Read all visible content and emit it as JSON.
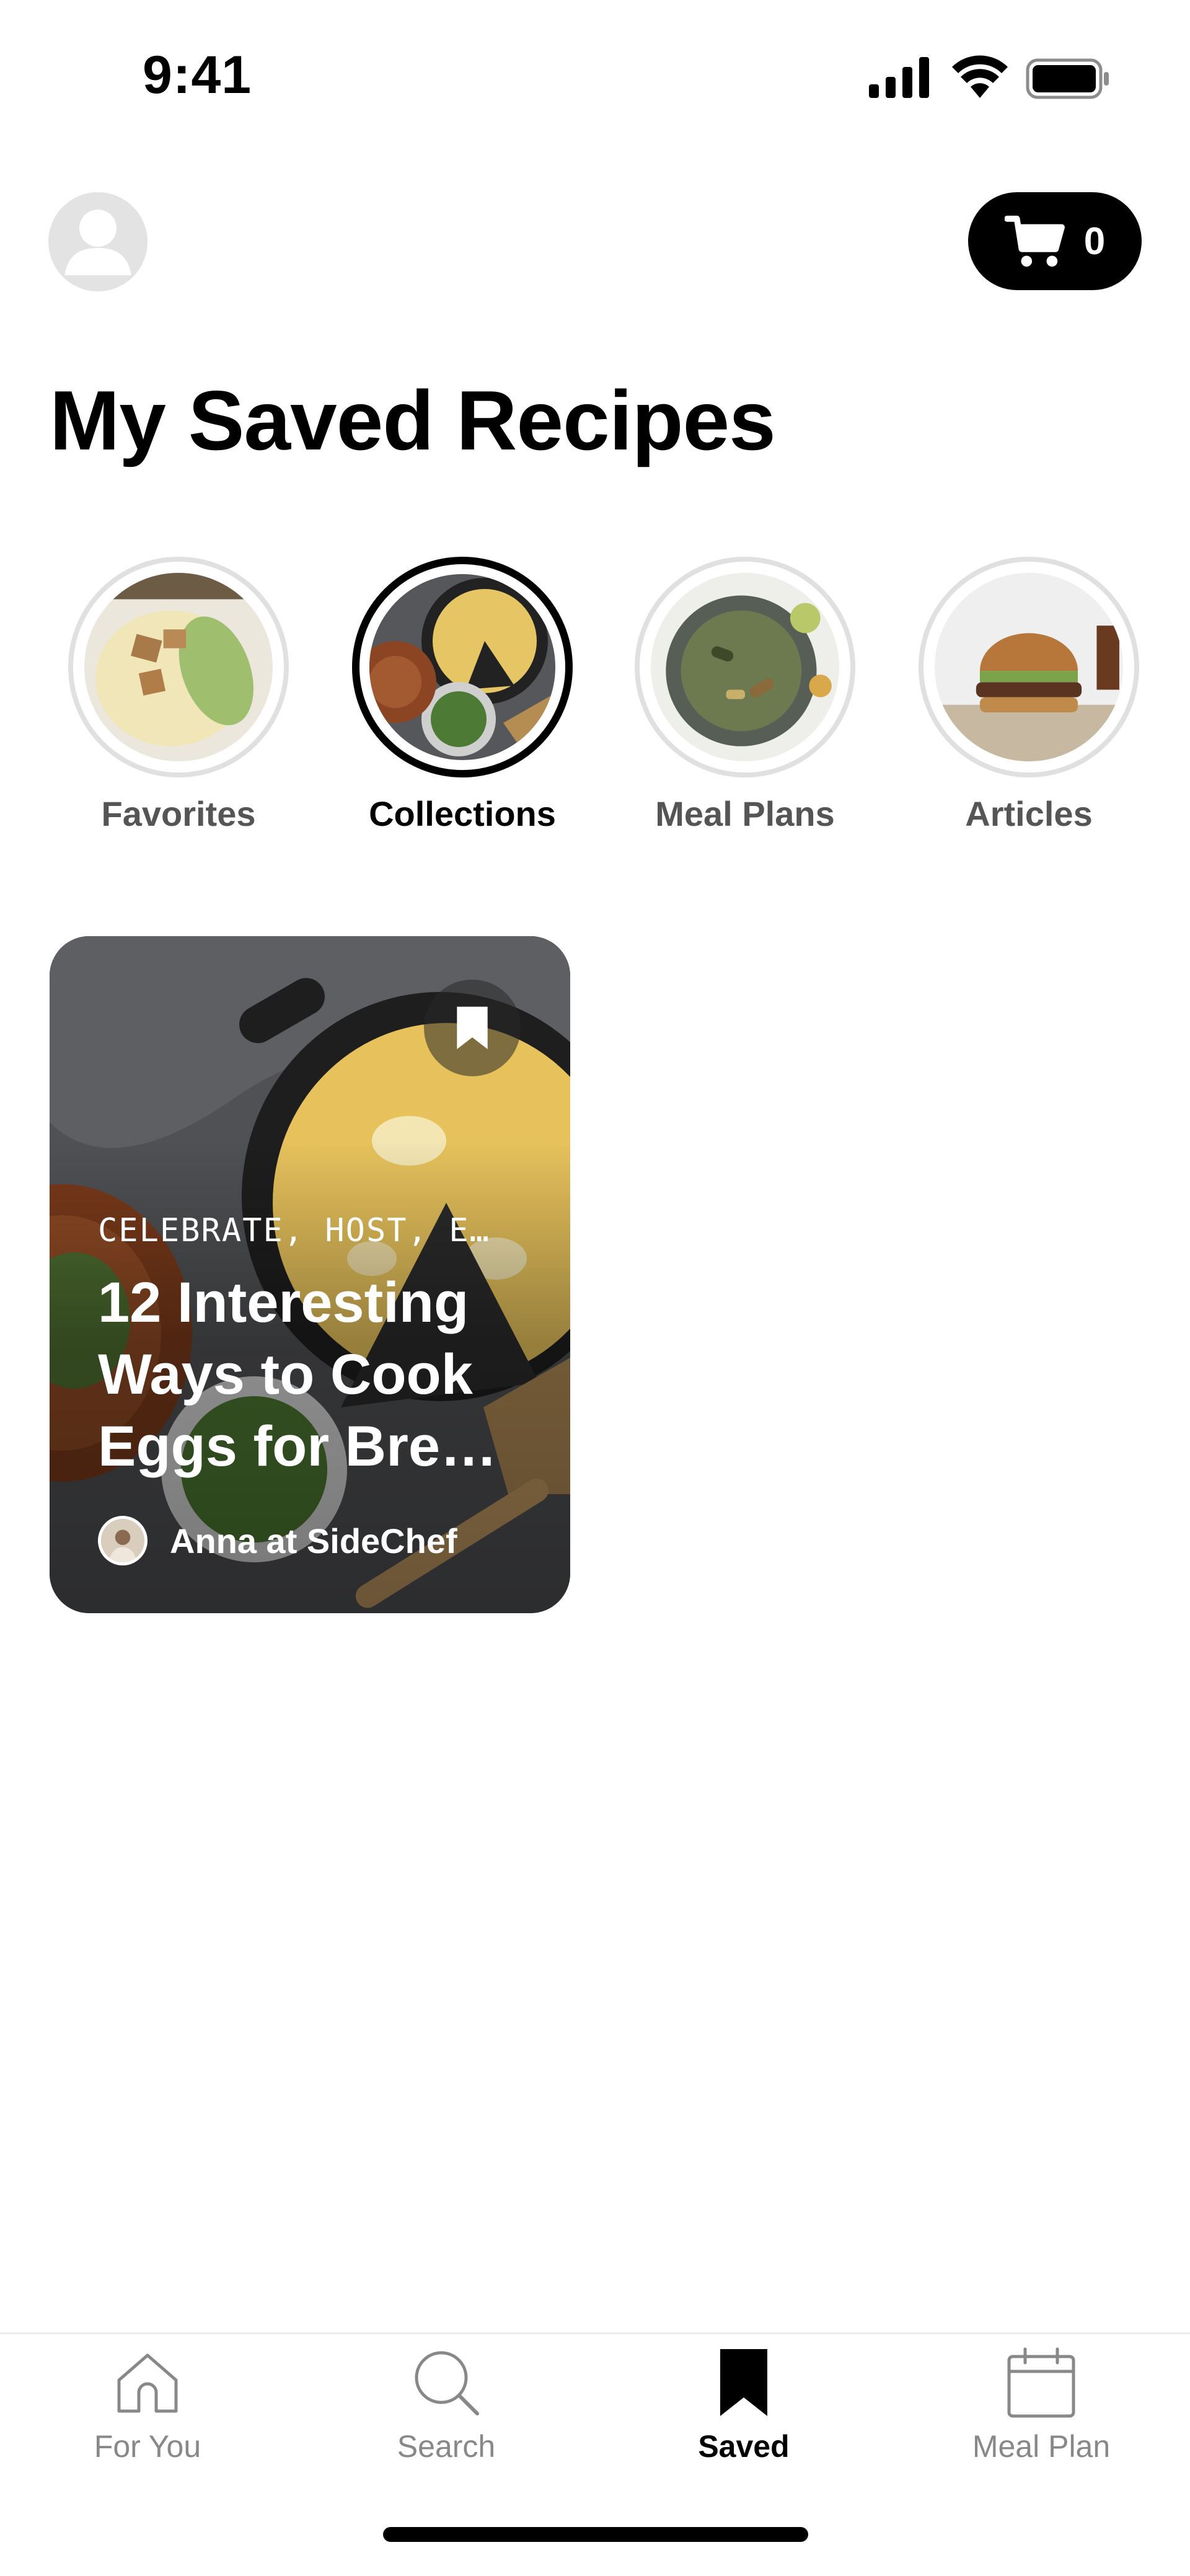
{
  "status_bar": {
    "time": "9:41"
  },
  "header": {
    "cart_count": "0",
    "title": "My Saved Recipes"
  },
  "categories": [
    {
      "label": "Favorites",
      "active": false
    },
    {
      "label": "Collections",
      "active": true
    },
    {
      "label": "Meal Plans",
      "active": false
    },
    {
      "label": "Articles",
      "active": false
    }
  ],
  "card": {
    "tags": "CELEBRATE, HOST, E…",
    "title": "12 Interesting Ways to Cook Eggs for Bre…",
    "author": "Anna at SideChef"
  },
  "tab_bar": {
    "items": [
      {
        "label": "For You",
        "icon": "home-icon",
        "active": false
      },
      {
        "label": "Search",
        "icon": "search-icon",
        "active": false
      },
      {
        "label": "Saved",
        "icon": "bookmark-icon",
        "active": true
      },
      {
        "label": "Meal Plan",
        "icon": "calendar-icon",
        "active": false
      }
    ]
  },
  "colors": {
    "primary": "#000000",
    "inactive_text": "#888888",
    "ring_inactive": "#e0e0e0"
  }
}
